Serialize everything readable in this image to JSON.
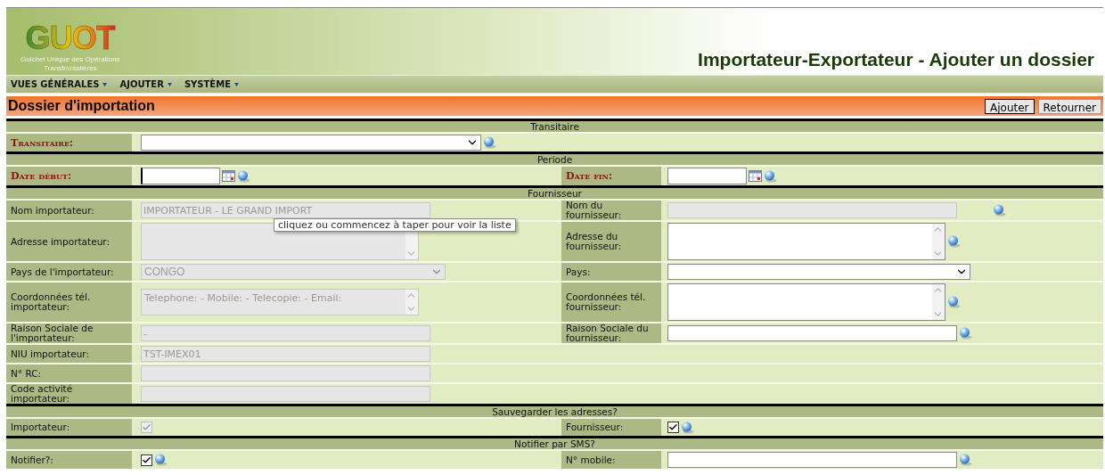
{
  "header": {
    "logo": {
      "title": "GUOT",
      "tagline": "Guichet Unique des Opérations",
      "tagline_2": "Transfrontalières"
    },
    "page_title": "Importateur-Exportateur - Ajouter un dossier"
  },
  "menu": [
    {
      "label": "VUES GÉNÉRALES"
    },
    {
      "label": "AJOUTER"
    },
    {
      "label": "SYSTÈME"
    }
  ],
  "form": {
    "title": "Dossier d'importation",
    "buttons": [
      "Ajouter",
      "Retourner"
    ],
    "sections": [
      {
        "title": "Transitaire",
        "rows": [
          {
            "cells": [
              {
                "label": "Transitaire:",
                "required": true,
                "kind": "select",
                "disabled": false,
                "help": true
              }
            ]
          }
        ]
      },
      {
        "title": "Periode",
        "rows": [
          {
            "cells": [
              {
                "label": "Date début:",
                "required": true,
                "kind": "date",
                "disabled": false,
                "help": true
              },
              {
                "label": "Date fin:",
                "required": true,
                "kind": "date",
                "disabled": false,
                "help": true
              }
            ]
          }
        ]
      },
      {
        "title": "Fournisseur",
        "rows": [
          {
            "cells": [
              {
                "label": "Nom importateur:",
                "required": false,
                "kind": "text",
                "value": "IMPORTATEUR - LE GRAND IMPORT",
                "disabled": true,
                "help": false,
                "tooltip": "cliquez ou commencez à taper pour voir la liste"
              },
              {
                "label": "Nom du fournisseur:",
                "required": false,
                "kind": "text",
                "disabled": true,
                "help": true
              }
            ]
          },
          {
            "cells": [
              {
                "label": "Adresse importateur:",
                "required": false,
                "kind": "textarea",
                "disabled": true,
                "help": false
              },
              {
                "label": "Adresse du fournisseur:",
                "required": false,
                "kind": "textarea",
                "disabled": false,
                "help": true
              }
            ]
          },
          {
            "cells": [
              {
                "label": "Pays de l'importateur:",
                "required": false,
                "kind": "select",
                "value": "CONGO",
                "disabled": true,
                "help": false
              },
              {
                "label": "Pays:",
                "required": false,
                "kind": "select",
                "disabled": false,
                "help": false
              }
            ]
          },
          {
            "cells": [
              {
                "label": "Coordonnées tél. importateur:",
                "required": false,
                "kind": "textarea",
                "value": "Telephone:  - Mobile: - Telecopie: - Email:",
                "disabled": true,
                "help": false
              },
              {
                "label": "Coordonnées tél. fournisseur:",
                "required": false,
                "kind": "textarea",
                "disabled": false,
                "help": true
              }
            ]
          },
          {
            "cells": [
              {
                "label": "Raison Sociale de l'importateur:",
                "required": false,
                "kind": "text",
                "value": "-",
                "disabled": true,
                "help": false
              },
              {
                "label": "Raison Sociale du fournisseur:",
                "required": false,
                "kind": "text",
                "disabled": false,
                "help": true
              }
            ]
          },
          {
            "cells": [
              {
                "label": "NIU importateur:",
                "required": false,
                "kind": "text",
                "value": "TST-IMEX01",
                "disabled": true,
                "help": false
              }
            ]
          },
          {
            "cells": [
              {
                "label": "N° RC:",
                "required": false,
                "kind": "text",
                "disabled": true,
                "help": false
              }
            ]
          },
          {
            "cells": [
              {
                "label": "Code activité importateur:",
                "required": false,
                "kind": "text",
                "disabled": true,
                "help": false
              }
            ]
          }
        ]
      },
      {
        "title": "Sauvegarder les adresses?",
        "rows": [
          {
            "cells": [
              {
                "label": "Importateur:",
                "required": false,
                "kind": "checkbox",
                "checked": true,
                "disabled": true,
                "help": false
              },
              {
                "label": "Fournisseur:",
                "required": false,
                "kind": "checkbox",
                "checked": true,
                "disabled": false,
                "help": true
              }
            ]
          }
        ]
      },
      {
        "title": "Notifier par SMS?",
        "rows": [
          {
            "cells": [
              {
                "label": "Notifier?:",
                "required": false,
                "kind": "checkbox",
                "checked": true,
                "disabled": false,
                "help": true
              },
              {
                "label": "N° mobile:",
                "required": false,
                "kind": "text",
                "disabled": false,
                "help": true
              }
            ]
          }
        ]
      }
    ]
  }
}
